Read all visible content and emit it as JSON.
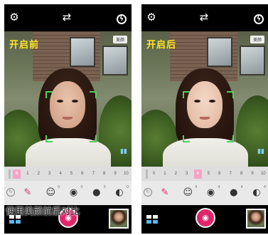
{
  "before": {
    "state_label": "开启前",
    "mode_badge": "美颜",
    "slider_ticks": [
      "0",
      "1",
      "2",
      "3",
      "4",
      "5",
      "6",
      "7",
      "8",
      "9",
      "10"
    ],
    "slider_selected": "0",
    "filters": [
      {
        "num": "",
        "icon": "beauty-wand-icon"
      },
      {
        "num": "0",
        "icon": "face-slim-icon"
      },
      {
        "num": "0",
        "icon": "eye-enlarge-icon"
      },
      {
        "num": "0",
        "icon": "skin-smooth-icon"
      },
      {
        "num": "0",
        "icon": "hair-style-icon"
      }
    ]
  },
  "after": {
    "state_label": "开启后",
    "mode_badge": "美颜",
    "slider_ticks": [
      "0",
      "1",
      "2",
      "3",
      "4",
      "5",
      "6",
      "7",
      "8",
      "9",
      "10"
    ],
    "slider_selected": "4",
    "filters": [
      {
        "num": "",
        "icon": "beauty-wand-icon"
      },
      {
        "num": "4",
        "icon": "face-slim-icon"
      },
      {
        "num": "4",
        "icon": "eye-enlarge-icon"
      },
      {
        "num": "4",
        "icon": "skin-smooth-icon"
      },
      {
        "num": "4",
        "icon": "hair-style-icon"
      }
    ]
  },
  "caption": "使用美颜前后对比",
  "colors": {
    "shutter": "#e0256a",
    "focus": "#4ed05a",
    "label": "#ffe52a",
    "slider_active": "#f6a3c6"
  },
  "icons": {
    "settings": "gear-icon",
    "camera_switch": "camera-switch-icon",
    "flash": "flash-icon",
    "grid": "grid-icon",
    "shutter": "camera-icon",
    "reset": "reset-icon",
    "audio": "sound-icon"
  }
}
